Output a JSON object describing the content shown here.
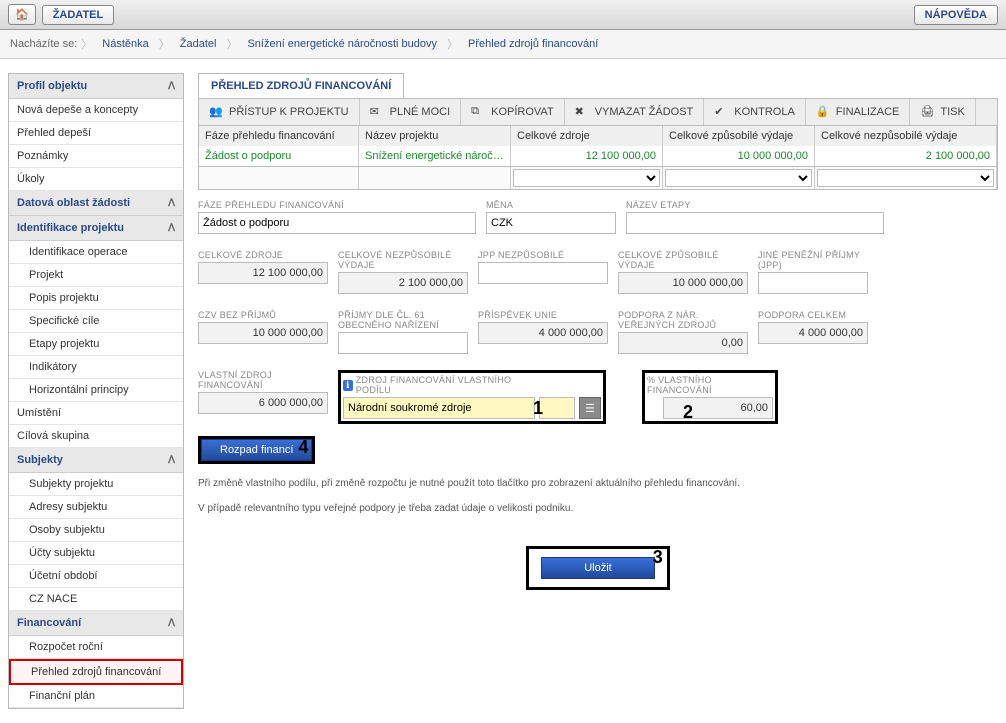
{
  "topbar": {
    "home": "🏠",
    "zadatel": "ŽADATEL",
    "napoveda": "NÁPOVĚDA"
  },
  "crumbs": {
    "label": "Nacházíte se:",
    "c1": "Nástěnka",
    "c2": "Žadatel",
    "c3": "Snížení energetické náročnosti budovy",
    "c4": "Přehled zdrojů financování"
  },
  "side": {
    "s1": "Profil objektu",
    "i1": "Nová depeše a koncepty",
    "i2": "Přehled depeší",
    "i3": "Poznámky",
    "i4": "Úkoly",
    "s2": "Datová oblast žádosti",
    "s3": "Identifikace projektu",
    "i5": "Identifikace operace",
    "i6": "Projekt",
    "i7": "Popis projektu",
    "i8": "Specifické cíle",
    "i9": "Etapy projektu",
    "i10": "Indikátory",
    "i11": "Horizontální principy",
    "i12": "Umístění",
    "i13": "Cílová skupina",
    "s4": "Subjekty",
    "i14": "Subjekty projektu",
    "i15": "Adresy subjektu",
    "i16": "Osoby subjektu",
    "i17": "Účty subjektu",
    "i18": "Účetní období",
    "i19": "CZ NACE",
    "s5": "Financování",
    "i20": "Rozpočet roční",
    "i21": "Přehled zdrojů financování",
    "i22": "Finanční plán"
  },
  "tab": "PŘEHLED ZDROJŮ FINANCOVÁNÍ",
  "tb": {
    "t1": "PŘÍSTUP K PROJEKTU",
    "t2": "PLNÉ MOCI",
    "t3": "KOPÍROVAT",
    "t4": "VYMAZAT ŽÁDOST",
    "t5": "KONTROLA",
    "t6": "FINALIZACE",
    "t7": "TISK"
  },
  "grid": {
    "h1": "Fáze přehledu financování",
    "h2": "Název projektu",
    "h3": "Celkové zdroje",
    "h4": "Celkové způsobilé výdaje",
    "h5": "Celkové nezpůsobilé výdaje",
    "r1c1": "Žádost o podporu",
    "r1c2": "Snížení energetické náročnosti...",
    "r1c3": "12 100 000,00",
    "r1c4": "10 000 000,00",
    "r1c5": "2 100 000,00"
  },
  "form": {
    "l_faze": "FÁZE PŘEHLEDU FINANCOVÁNÍ",
    "v_faze": "Žádost o podporu",
    "l_mena": "MĚNA",
    "v_mena": "CZK",
    "l_etapa": "NÁZEV ETAPY",
    "v_etapa": "",
    "l_cz": "CELKOVÉ ZDROJE",
    "v_cz": "12 100 000,00",
    "l_cnv": "CELKOVÉ NEZPŮSOBILÉ VÝDAJE",
    "v_cnv": "2 100 000,00",
    "l_jppn": "JPP NEZPŮSOBILÉ",
    "v_jppn": "",
    "l_czv": "CELKOVÉ ZPŮSOBILÉ VÝDAJE",
    "v_czv": "10 000 000,00",
    "l_jpp": "JINÉ PENĚŽNÍ PŘÍJMY (JPP)",
    "v_jpp": "",
    "l_cbp": "CZV BEZ PŘÍJMŮ",
    "v_cbp": "10 000 000,00",
    "l_p61": "PŘÍJMY DLE ČL. 61 OBECNÉHO NAŘÍZENÍ",
    "v_p61": "",
    "l_pu": "PŘÍSPĚVEK UNIE",
    "v_pu": "4 000 000,00",
    "l_pnvz": "PODPORA Z NÁR. VEŘEJNÝCH ZDROJŮ",
    "v_pnvz": "0,00",
    "l_pc": "PODPORA CELKEM",
    "v_pc": "4 000 000,00",
    "l_vzf": "VLASTNÍ ZDROJ FINANCOVÁNÍ",
    "v_vzf": "6 000 000,00",
    "l_zfvp": "ZDROJ FINANCOVÁNÍ VLASTNÍHO PODÍLU",
    "v_zfvp": "Národní soukromé zdroje",
    "l_pvf": "% VLASTNÍHO FINANCOVÁNÍ",
    "v_pvf": "60,00",
    "rozpad": "Rozpad financí",
    "ulozit": "Uložit",
    "info_icon": "ℹ",
    "note1": "Při změně vlastního podílu, při změně rozpočtu je nutné použít toto tlačítko pro zobrazení aktuálního přehledu financování.",
    "note2": "V případě relevantního typu veřejné podpory je třeba zadat údaje o velikosti podniku."
  },
  "marks": {
    "n1": "1",
    "n2": "2",
    "n3": "3",
    "n4": "4"
  }
}
